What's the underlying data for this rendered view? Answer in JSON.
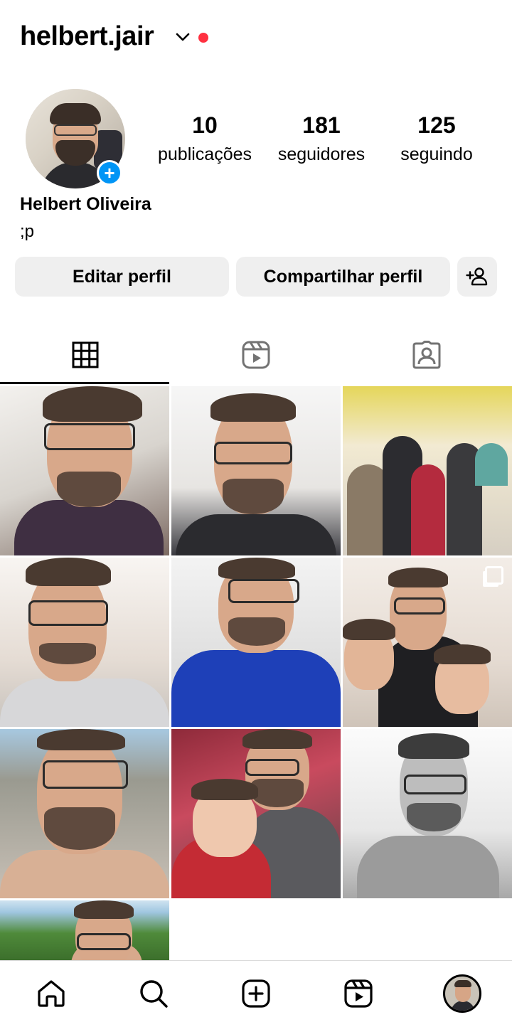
{
  "profile": {
    "username": "helbert.jair",
    "full_name": "Helbert Oliveira",
    "bio": ";p",
    "accent_color": "#0095f6",
    "notification_color": "#ff3040"
  },
  "stats": {
    "posts_count": "10",
    "posts_label": "publicações",
    "followers_count": "181",
    "followers_label": "seguidores",
    "following_count": "125",
    "following_label": "seguindo"
  },
  "actions": {
    "edit_label": "Editar perfil",
    "share_label": "Compartilhar perfil",
    "add_user_icon": "add-person-icon"
  },
  "tabs": [
    {
      "name": "posts-grid",
      "icon": "grid-icon",
      "active": true
    },
    {
      "name": "reels",
      "icon": "reels-icon",
      "active": false
    },
    {
      "name": "tagged",
      "icon": "tagged-user-icon",
      "active": false
    }
  ],
  "posts": [
    {
      "description": "selfie pointing",
      "multi": false
    },
    {
      "description": "selfie gaming chair",
      "multi": false
    },
    {
      "description": "group photo",
      "multi": false
    },
    {
      "description": "selfie peace sign",
      "multi": false
    },
    {
      "description": "selfie blue jersey",
      "multi": false
    },
    {
      "description": "with children",
      "multi": true
    },
    {
      "description": "outdoor selfie",
      "multi": false
    },
    {
      "description": "with baby",
      "multi": false
    },
    {
      "description": "black and white selfie",
      "multi": false
    },
    {
      "description": "hills selfie",
      "multi": false
    }
  ],
  "bottom_nav": [
    {
      "name": "home",
      "icon": "home-icon"
    },
    {
      "name": "search",
      "icon": "search-icon"
    },
    {
      "name": "create",
      "icon": "plus-square-icon"
    },
    {
      "name": "reels",
      "icon": "reels-icon"
    },
    {
      "name": "profile",
      "icon": "profile-avatar"
    }
  ]
}
